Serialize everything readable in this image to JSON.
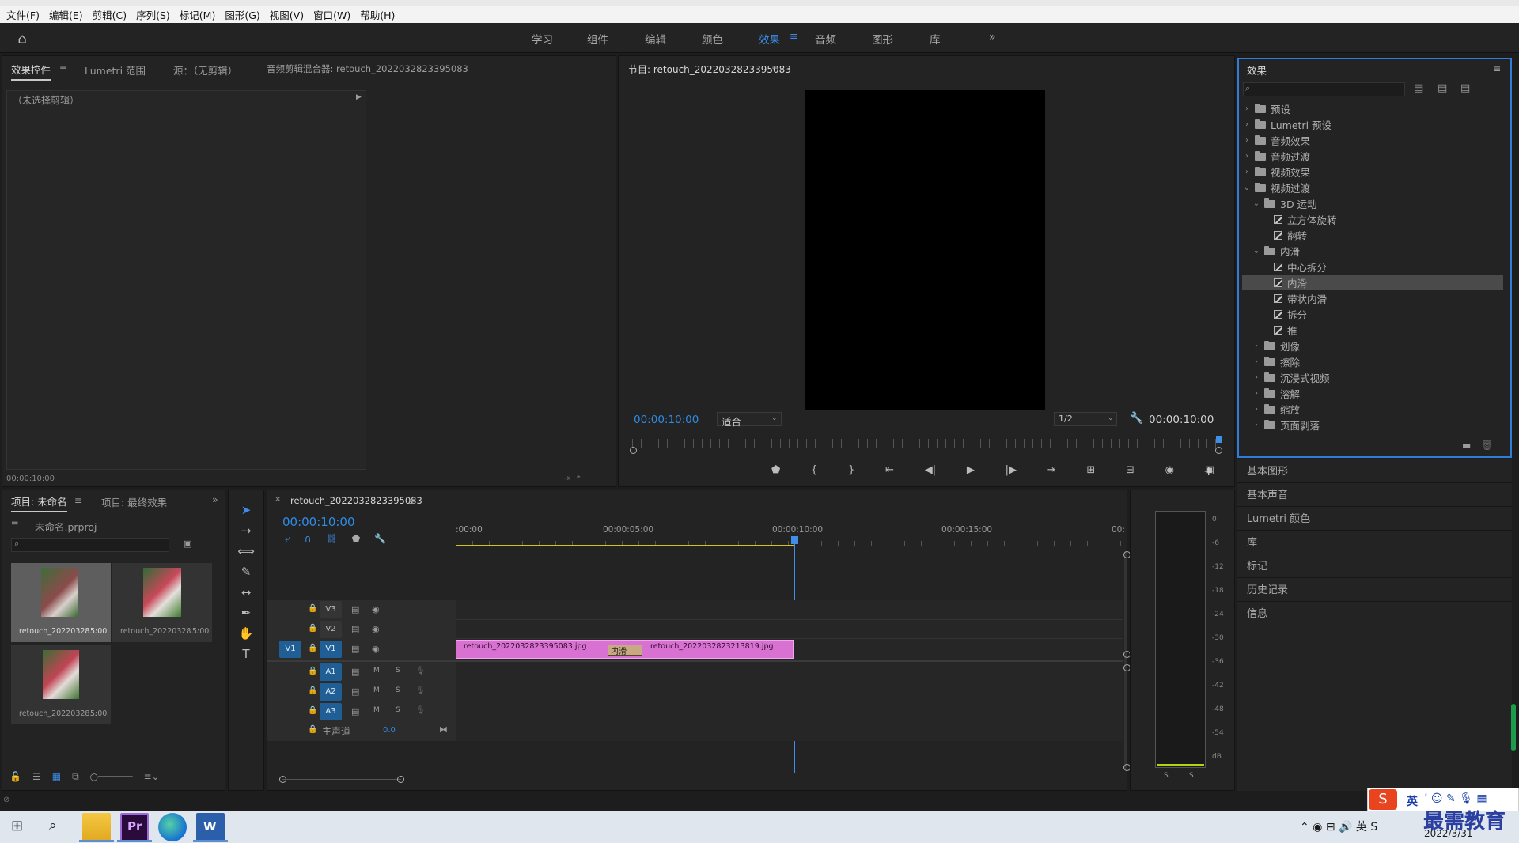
{
  "menu": [
    "文件(F)",
    "编辑(E)",
    "剪辑(C)",
    "序列(S)",
    "标记(M)",
    "图形(G)",
    "视图(V)",
    "窗口(W)",
    "帮助(H)"
  ],
  "workspaces": [
    "学习",
    "组件",
    "编辑",
    "颜色",
    "效果",
    "音频",
    "图形",
    "库"
  ],
  "active_workspace": "效果",
  "source_panel": {
    "tabs": [
      "效果控件",
      "Lumetri 范围",
      "源：（无剪辑）",
      "音频剪辑混合器: retouch_2022032823395083"
    ],
    "no_clip": "（未选择剪辑）",
    "timecode": "00:00:10:00"
  },
  "program": {
    "title": "节目: retouch_2022032823395083",
    "tc_left": "00:00:10:00",
    "fit": "适合",
    "quality": "1/2",
    "tc_right": "00:00:10:00"
  },
  "effects_panel": {
    "title": "效果",
    "tree": [
      {
        "label": "预设",
        "level": 0,
        "type": "folder-star",
        "open": false
      },
      {
        "label": "Lumetri 预设",
        "level": 0,
        "type": "folder-star",
        "open": false
      },
      {
        "label": "音频效果",
        "level": 0,
        "type": "folder",
        "open": false
      },
      {
        "label": "音频过渡",
        "level": 0,
        "type": "folder",
        "open": false
      },
      {
        "label": "视频效果",
        "level": 0,
        "type": "folder",
        "open": false
      },
      {
        "label": "视频过渡",
        "level": 0,
        "type": "folder",
        "open": true
      },
      {
        "label": "3D 运动",
        "level": 1,
        "type": "folder",
        "open": true
      },
      {
        "label": "立方体旋转",
        "level": 2,
        "type": "fx"
      },
      {
        "label": "翻转",
        "level": 2,
        "type": "fx"
      },
      {
        "label": "内滑",
        "level": 1,
        "type": "folder",
        "open": true
      },
      {
        "label": "中心拆分",
        "level": 2,
        "type": "fx"
      },
      {
        "label": "内滑",
        "level": 2,
        "type": "fx",
        "selected": true
      },
      {
        "label": "带状内滑",
        "level": 2,
        "type": "fx"
      },
      {
        "label": "拆分",
        "level": 2,
        "type": "fx"
      },
      {
        "label": "推",
        "level": 2,
        "type": "fx"
      },
      {
        "label": "划像",
        "level": 1,
        "type": "folder",
        "open": false
      },
      {
        "label": "擦除",
        "level": 1,
        "type": "folder",
        "open": false
      },
      {
        "label": "沉浸式视频",
        "level": 1,
        "type": "folder",
        "open": false
      },
      {
        "label": "溶解",
        "level": 1,
        "type": "folder",
        "open": false
      },
      {
        "label": "缩放",
        "level": 1,
        "type": "folder",
        "open": false
      },
      {
        "label": "页面剥落",
        "level": 1,
        "type": "folder",
        "open": false
      }
    ]
  },
  "side_panels": [
    "基本图形",
    "基本声音",
    "Lumetri 颜色",
    "库",
    "标记",
    "历史记录",
    "信息"
  ],
  "project": {
    "tabs": [
      "项目: 未命名",
      "项目: 最终效果"
    ],
    "file": "未命名.prproj",
    "items": [
      {
        "name": "retouch_20220328...",
        "dur": "5:00"
      },
      {
        "name": "retouch_20220328...",
        "dur": "5:00"
      },
      {
        "name": "retouch_20220328...",
        "dur": "5:00"
      }
    ]
  },
  "timeline": {
    "tab": "retouch_2022032823395083",
    "timecode": "00:00:10:00",
    "ruler": [
      ":00:00",
      "00:00:05:00",
      "00:00:10:00",
      "00:00:15:00",
      "00:"
    ],
    "video_tracks": [
      "V3",
      "V2",
      "V1"
    ],
    "audio_tracks": [
      "A1",
      "A2",
      "A3"
    ],
    "src_patch": "V1",
    "master": "主声道",
    "master_val": "0.0",
    "clip1": "retouch_2022032823395083.jpg",
    "clip2": "retouch_2022032823213819.jpg",
    "transition": "内滑"
  },
  "meter": {
    "ticks": [
      "0",
      "-6",
      "-12",
      "-18",
      "-24",
      "-30",
      "-36",
      "-42",
      "-48",
      "-54",
      "dB"
    ],
    "solo": [
      "S",
      "S"
    ]
  },
  "taskbar": {
    "ime": "英",
    "date": "2022/3/31",
    "watermark": "最需教育"
  }
}
